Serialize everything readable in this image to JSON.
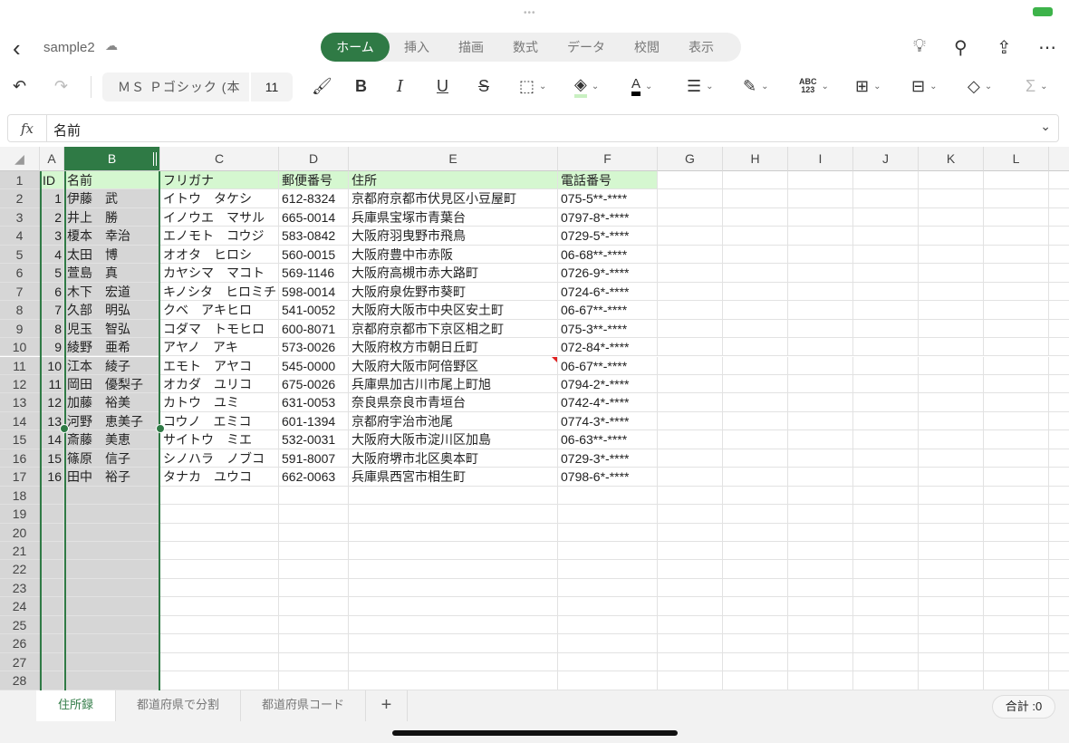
{
  "app": {
    "file_name": "sample2"
  },
  "ribbon": {
    "tabs": [
      "ホーム",
      "挿入",
      "描画",
      "数式",
      "データ",
      "校閲",
      "表示"
    ],
    "active_tab": "ホーム"
  },
  "toolbar": {
    "font_name": "ＭＳ Ｐゴシック (本",
    "font_size": "11",
    "number_format_label": "ABC\n123"
  },
  "formula_bar": {
    "fx": "fx",
    "value": "名前"
  },
  "sheet": {
    "columns": [
      "A",
      "B",
      "C",
      "D",
      "E",
      "F",
      "G",
      "H",
      "I",
      "J",
      "K",
      "L"
    ],
    "selected_column": "B",
    "row_count": 28,
    "header_row": [
      "ID",
      "名前",
      "フリガナ",
      "郵便番号",
      "住所",
      "電話番号"
    ],
    "rows": [
      [
        "1",
        "伊藤　武",
        "イトウ　タケシ",
        "612-8324",
        "京都府京都市伏見区小豆屋町",
        "075-5**-****"
      ],
      [
        "2",
        "井上　勝",
        "イノウエ　マサル",
        "665-0014",
        "兵庫県宝塚市青葉台",
        "0797-8*-****"
      ],
      [
        "3",
        "榎本　幸治",
        "エノモト　コウジ",
        "583-0842",
        "大阪府羽曳野市飛鳥",
        "0729-5*-****"
      ],
      [
        "4",
        "太田　博",
        "オオタ　ヒロシ",
        "560-0015",
        "大阪府豊中市赤阪",
        "06-68**-****"
      ],
      [
        "5",
        "萱島　真",
        "カヤシマ　マコト",
        "569-1146",
        "大阪府高槻市赤大路町",
        "0726-9*-****"
      ],
      [
        "6",
        "木下　宏道",
        "キノシタ　ヒロミチ",
        "598-0014",
        "大阪府泉佐野市葵町",
        "0724-6*-****"
      ],
      [
        "7",
        "久部　明弘",
        "クベ　アキヒロ",
        "541-0052",
        "大阪府大阪市中央区安土町",
        "06-67**-****"
      ],
      [
        "8",
        "児玉　智弘",
        "コダマ　トモヒロ",
        "600-8071",
        "京都府京都市下京区相之町",
        "075-3**-****"
      ],
      [
        "9",
        "綾野　亜希",
        "アヤノ　アキ",
        "573-0026",
        "大阪府枚方市朝日丘町",
        "072-84*-****"
      ],
      [
        "10",
        "江本　綾子",
        "エモト　アヤコ",
        "545-0000",
        "大阪府大阪市阿倍野区",
        "06-67**-****"
      ],
      [
        "11",
        "岡田　優梨子",
        "オカダ　ユリコ",
        "675-0026",
        "兵庫県加古川市尾上町旭",
        "0794-2*-****"
      ],
      [
        "12",
        "加藤　裕美",
        "カトウ　ユミ",
        "631-0053",
        "奈良県奈良市青垣台",
        "0742-4*-****"
      ],
      [
        "13",
        "河野　恵美子",
        "コウノ　エミコ",
        "601-1394",
        "京都府宇治市池尾",
        "0774-3*-****"
      ],
      [
        "14",
        "斎藤　美恵",
        "サイトウ　ミエ",
        "532-0031",
        "大阪府大阪市淀川区加島",
        "06-63**-****"
      ],
      [
        "15",
        "篠原　信子",
        "シノハラ　ノブコ",
        "591-8007",
        "大阪府堺市北区奥本町",
        "0729-3*-****"
      ],
      [
        "16",
        "田中　裕子",
        "タナカ　ユウコ",
        "662-0063",
        "兵庫県西宮市相生町",
        "0798-6*-****"
      ]
    ],
    "colors": {
      "accent": "#2f7a45",
      "header_fill": "#d5f7d0",
      "selection_fill": "#d6d6d6"
    }
  },
  "sheet_tabs": [
    "住所録",
    "都道府県で分割",
    "都道府県コード"
  ],
  "add_sheet_label": "+",
  "status": {
    "sum_label": "合計 :0"
  }
}
